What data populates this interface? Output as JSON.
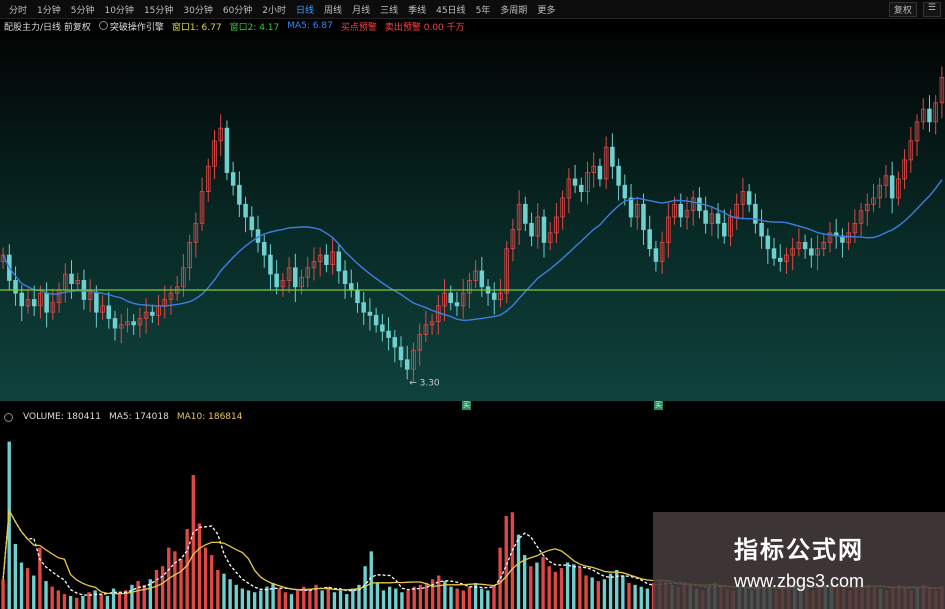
{
  "toolbar": {
    "periods": [
      "分时",
      "1分钟",
      "5分钟",
      "10分钟",
      "15分钟",
      "30分钟",
      "60分钟",
      "2小时",
      "日线",
      "周线",
      "月线",
      "三线",
      "季线",
      "45日线",
      "5年",
      "多周期",
      "更多"
    ],
    "active_period": "日线",
    "right_buttons": [
      "复权",
      "☰"
    ]
  },
  "infobar": {
    "title": "配股主力/日线 前复权",
    "indicator": "突破操作引擎",
    "items": [
      {
        "text": "窗口1: 6.77",
        "color": "#dddd33"
      },
      {
        "text": "窗口2: 4.17",
        "color": "#33cc33"
      },
      {
        "text": "MA5: 6.87",
        "color": "#3388ff"
      },
      {
        "text": "买点预警",
        "color": "#ff4444"
      },
      {
        "text": "卖出预警 0.00 千万",
        "color": "#ff4444"
      }
    ]
  },
  "vol_header": {
    "items": [
      {
        "text": "VOLUME: 180411",
        "color": "#dddddd"
      },
      {
        "text": "MA5: 174018",
        "color": "#dddddd"
      },
      {
        "text": "MA10: 186814",
        "color": "#e8c84a"
      }
    ]
  },
  "markers": [
    "买",
    "买"
  ],
  "watermark": {
    "title": "指标公式网",
    "url": "www.zbgs3.com"
  },
  "colors": {
    "up": "#e04848",
    "down": "#6fd0d0",
    "ma_price": "#3d7fe0",
    "support": "#7ccf2a",
    "ma5": "#ffffff",
    "ma10": "#e8c84a"
  },
  "chart_data": {
    "type": "candlestick",
    "price_panel": {
      "ylim": [
        2.8,
        8.6
      ],
      "support_level": 4.55,
      "low_annotation": {
        "text": "← 3.30",
        "value": 3.3
      },
      "close": [
        5.1,
        4.7,
        4.5,
        4.3,
        4.4,
        4.3,
        4.5,
        4.2,
        4.35,
        4.55,
        4.8,
        4.65,
        4.7,
        4.4,
        4.5,
        4.2,
        4.3,
        4.1,
        3.95,
        4.0,
        4.05,
        4.0,
        4.1,
        4.2,
        4.15,
        4.3,
        4.4,
        4.5,
        4.6,
        4.9,
        5.3,
        5.6,
        6.1,
        6.5,
        6.9,
        7.1,
        6.4,
        6.2,
        5.9,
        5.7,
        5.5,
        5.3,
        5.1,
        4.8,
        4.6,
        4.7,
        4.9,
        4.6,
        4.75,
        4.9,
        5.0,
        5.1,
        4.95,
        5.15,
        4.85,
        4.65,
        4.55,
        4.35,
        4.2,
        4.15,
        4.0,
        3.9,
        3.8,
        3.65,
        3.45,
        3.3,
        3.6,
        3.85,
        4.0,
        4.05,
        4.3,
        4.5,
        4.35,
        4.3,
        4.5,
        4.7,
        4.85,
        4.6,
        4.5,
        4.4,
        4.5,
        5.2,
        5.5,
        5.9,
        5.6,
        5.4,
        5.7,
        5.3,
        5.45,
        5.7,
        6.0,
        6.3,
        6.2,
        6.1,
        6.4,
        6.5,
        6.3,
        6.8,
        6.5,
        6.2,
        6.0,
        5.7,
        5.9,
        5.5,
        5.2,
        5.0,
        5.3,
        5.7,
        5.9,
        5.7,
        5.8,
        6.0,
        5.8,
        5.6,
        5.75,
        5.6,
        5.4,
        5.7,
        5.9,
        6.1,
        5.9,
        5.6,
        5.4,
        5.2,
        5.05,
        5.0,
        5.1,
        5.2,
        5.3,
        5.2,
        5.1,
        5.2,
        5.3,
        5.45,
        5.4,
        5.3,
        5.45,
        5.6,
        5.8,
        5.9,
        6.0,
        6.2,
        6.35,
        6.0,
        6.3,
        6.6,
        6.9,
        7.2,
        7.4,
        7.2,
        7.5,
        7.9
      ]
    },
    "volume_panel": {
      "values": [
        1.6,
        9.0,
        3.5,
        2.5,
        2.2,
        1.8,
        3.3,
        1.5,
        1.2,
        1.0,
        0.8,
        0.7,
        0.6,
        0.7,
        0.9,
        1.0,
        0.8,
        0.7,
        1.1,
        0.9,
        1.0,
        1.3,
        1.5,
        1.3,
        1.6,
        2.1,
        2.3,
        3.3,
        3.1,
        2.7,
        4.3,
        7.2,
        4.6,
        3.3,
        2.9,
        2.1,
        1.9,
        1.6,
        1.3,
        1.1,
        1.0,
        0.9,
        1.0,
        1.2,
        1.4,
        1.1,
        0.9,
        0.8,
        1.0,
        1.2,
        1.1,
        1.3,
        1.0,
        1.2,
        0.9,
        1.0,
        0.8,
        1.1,
        1.3,
        2.3,
        3.1,
        1.4,
        1.0,
        1.2,
        1.1,
        0.9,
        1.0,
        1.2,
        1.3,
        1.4,
        1.6,
        1.8,
        1.5,
        1.2,
        1.1,
        1.0,
        1.2,
        1.4,
        1.1,
        1.0,
        1.3,
        3.3,
        5.0,
        5.2,
        4.0,
        2.9,
        2.3,
        2.5,
        2.8,
        2.3,
        2.0,
        2.2,
        2.5,
        2.4,
        2.2,
        1.8,
        1.7,
        1.5,
        1.6,
        1.9,
        2.1,
        1.8,
        1.4,
        1.3,
        1.2,
        1.1,
        1.4,
        1.6,
        1.5,
        1.3,
        1.2,
        1.4,
        1.3,
        1.1,
        1.0,
        1.2,
        1.4,
        1.3,
        1.1,
        1.0,
        1.2,
        1.1,
        1.0,
        1.3,
        1.2,
        1.1,
        1.0,
        1.2,
        1.4,
        1.3,
        1.2,
        1.1,
        1.0,
        1.2,
        1.3,
        1.4,
        1.2,
        1.1,
        1.0,
        1.2,
        1.4,
        1.3,
        1.2,
        1.1,
        1.0,
        1.2,
        1.3,
        1.1,
        1.0,
        1.2,
        1.3,
        1.1,
        1.0,
        1.2
      ],
      "ylim": [
        0,
        10
      ]
    }
  }
}
